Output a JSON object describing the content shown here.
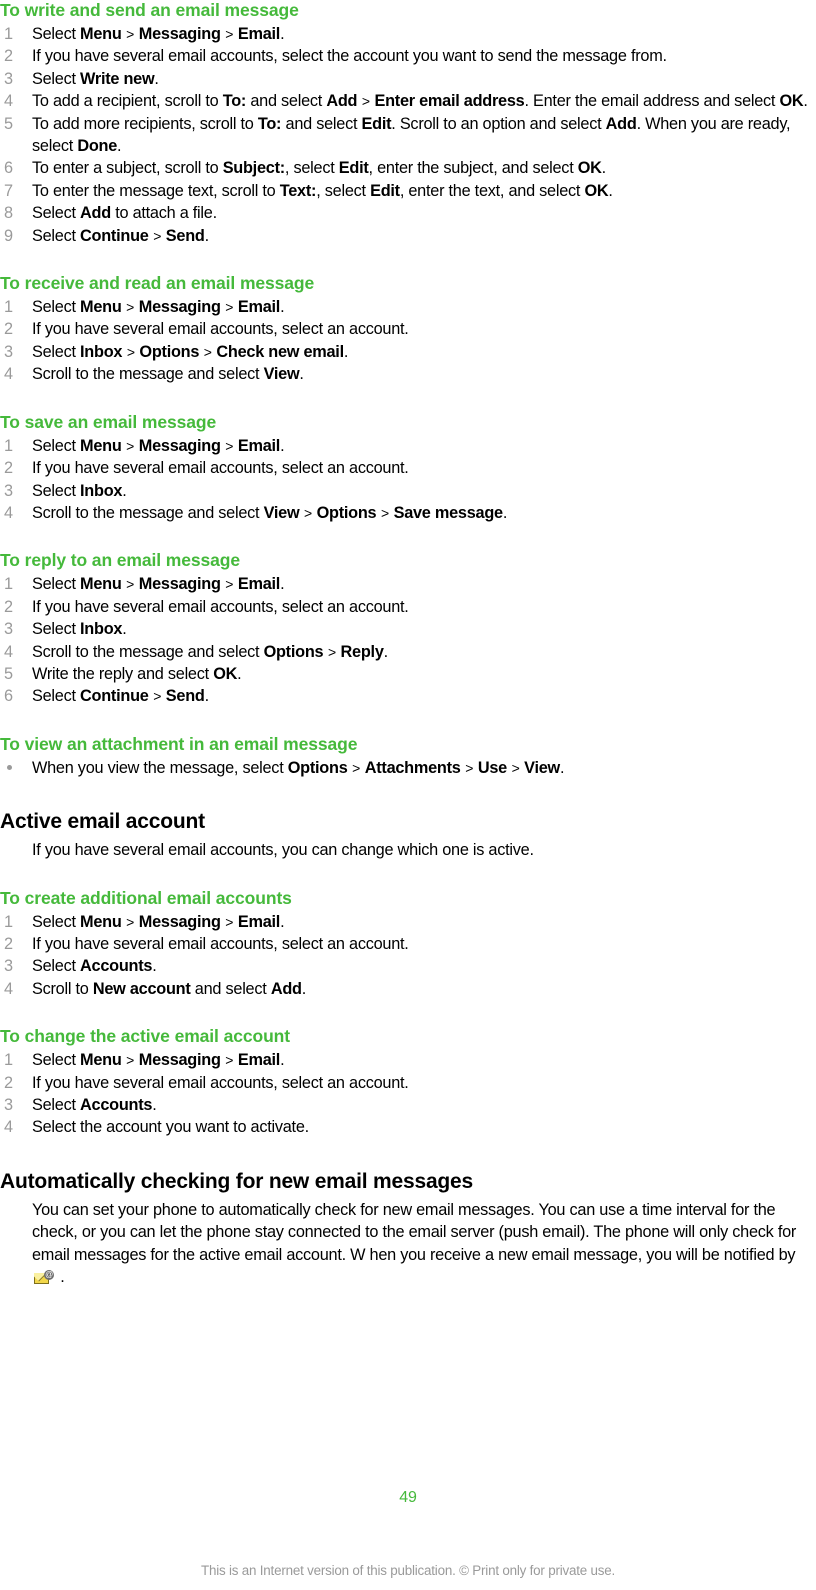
{
  "document": {
    "page_number": "49",
    "footer_note": "This is an Internet version of this publication. © Print only for private use.",
    "heading_color": "#45b93b",
    "number_color": "#9a9a9a",
    "body_color": "#000000"
  },
  "sections": [
    {
      "id": "write-send",
      "type": "procedure",
      "heading": "To write and send an email message",
      "steps": [
        {
          "num": "1",
          "parts": [
            {
              "t": "Select "
            },
            {
              "t": "Menu",
              "b": true
            },
            {
              "t": " > ",
              "gt": true
            },
            {
              "t": "Messaging",
              "b": true
            },
            {
              "t": " > ",
              "gt": true
            },
            {
              "t": "Email",
              "b": true
            },
            {
              "t": "."
            }
          ]
        },
        {
          "num": "2",
          "parts": [
            {
              "t": "If you have several email accounts, select the account you want to send the message from."
            }
          ]
        },
        {
          "num": "3",
          "parts": [
            {
              "t": "Select "
            },
            {
              "t": "Write new",
              "b": true
            },
            {
              "t": "."
            }
          ]
        },
        {
          "num": "4",
          "parts": [
            {
              "t": "To add a recipient, scroll to "
            },
            {
              "t": "To:",
              "b": true
            },
            {
              "t": " and select "
            },
            {
              "t": "Add",
              "b": true
            },
            {
              "t": " > ",
              "gt": true
            },
            {
              "t": "Enter email address",
              "b": true
            },
            {
              "t": ". Enter the email address and select "
            },
            {
              "t": "OK",
              "b": true
            },
            {
              "t": "."
            }
          ]
        },
        {
          "num": "5",
          "parts": [
            {
              "t": "To add more recipients, scroll to "
            },
            {
              "t": "To:",
              "b": true
            },
            {
              "t": " and select "
            },
            {
              "t": "Edit",
              "b": true
            },
            {
              "t": ". Scroll to an option and select "
            },
            {
              "t": "Add",
              "b": true
            },
            {
              "t": ". When you are ready, select "
            },
            {
              "t": "Done",
              "b": true
            },
            {
              "t": "."
            }
          ]
        },
        {
          "num": "6",
          "parts": [
            {
              "t": "To enter a subject, scroll to "
            },
            {
              "t": "Subject:",
              "b": true
            },
            {
              "t": ", select "
            },
            {
              "t": "Edit",
              "b": true
            },
            {
              "t": ", enter the subject, and select "
            },
            {
              "t": "OK",
              "b": true
            },
            {
              "t": "."
            }
          ]
        },
        {
          "num": "7",
          "parts": [
            {
              "t": "To enter the message text, scroll to "
            },
            {
              "t": "Text:",
              "b": true
            },
            {
              "t": ", select "
            },
            {
              "t": "Edit",
              "b": true
            },
            {
              "t": ", enter the text, and select "
            },
            {
              "t": "OK",
              "b": true
            },
            {
              "t": "."
            }
          ]
        },
        {
          "num": "8",
          "parts": [
            {
              "t": "Select "
            },
            {
              "t": "Add",
              "b": true
            },
            {
              "t": " to attach a file."
            }
          ]
        },
        {
          "num": "9",
          "parts": [
            {
              "t": "Select "
            },
            {
              "t": "Continue",
              "b": true
            },
            {
              "t": " > ",
              "gt": true
            },
            {
              "t": "Send",
              "b": true
            },
            {
              "t": "."
            }
          ]
        }
      ]
    },
    {
      "id": "receive-read",
      "type": "procedure",
      "heading": "To receive and read an email message",
      "steps": [
        {
          "num": "1",
          "parts": [
            {
              "t": "Select "
            },
            {
              "t": "Menu",
              "b": true
            },
            {
              "t": " > ",
              "gt": true
            },
            {
              "t": "Messaging",
              "b": true
            },
            {
              "t": " > ",
              "gt": true
            },
            {
              "t": "Email",
              "b": true
            },
            {
              "t": "."
            }
          ]
        },
        {
          "num": "2",
          "parts": [
            {
              "t": "If you have several email accounts, select an account."
            }
          ]
        },
        {
          "num": "3",
          "parts": [
            {
              "t": "Select "
            },
            {
              "t": "Inbox",
              "b": true
            },
            {
              "t": " > ",
              "gt": true
            },
            {
              "t": "Options",
              "b": true
            },
            {
              "t": " > ",
              "gt": true
            },
            {
              "t": "Check new email",
              "b": true
            },
            {
              "t": "."
            }
          ]
        },
        {
          "num": "4",
          "parts": [
            {
              "t": "Scroll to the message and select "
            },
            {
              "t": "View",
              "b": true
            },
            {
              "t": "."
            }
          ]
        }
      ]
    },
    {
      "id": "save",
      "type": "procedure",
      "heading": "To save an email message",
      "steps": [
        {
          "num": "1",
          "parts": [
            {
              "t": "Select "
            },
            {
              "t": "Menu",
              "b": true
            },
            {
              "t": " > ",
              "gt": true
            },
            {
              "t": "Messaging",
              "b": true
            },
            {
              "t": " > ",
              "gt": true
            },
            {
              "t": "Email",
              "b": true
            },
            {
              "t": "."
            }
          ]
        },
        {
          "num": "2",
          "parts": [
            {
              "t": "If you have several email accounts, select an account."
            }
          ]
        },
        {
          "num": "3",
          "parts": [
            {
              "t": "Select "
            },
            {
              "t": "Inbox",
              "b": true
            },
            {
              "t": "."
            }
          ]
        },
        {
          "num": "4",
          "parts": [
            {
              "t": "Scroll to the message and select "
            },
            {
              "t": "View",
              "b": true
            },
            {
              "t": " > ",
              "gt": true
            },
            {
              "t": "Options",
              "b": true
            },
            {
              "t": " > ",
              "gt": true
            },
            {
              "t": "Save message",
              "b": true
            },
            {
              "t": "."
            }
          ]
        }
      ]
    },
    {
      "id": "reply",
      "type": "procedure",
      "heading": "To reply to an email message",
      "steps": [
        {
          "num": "1",
          "parts": [
            {
              "t": "Select "
            },
            {
              "t": "Menu",
              "b": true
            },
            {
              "t": " > ",
              "gt": true
            },
            {
              "t": "Messaging",
              "b": true
            },
            {
              "t": " > ",
              "gt": true
            },
            {
              "t": "Email",
              "b": true
            },
            {
              "t": "."
            }
          ]
        },
        {
          "num": "2",
          "parts": [
            {
              "t": "If you have several email accounts, select an account."
            }
          ]
        },
        {
          "num": "3",
          "parts": [
            {
              "t": "Select "
            },
            {
              "t": "Inbox",
              "b": true
            },
            {
              "t": "."
            }
          ]
        },
        {
          "num": "4",
          "parts": [
            {
              "t": "Scroll to the message and select "
            },
            {
              "t": "Options",
              "b": true
            },
            {
              "t": " > ",
              "gt": true
            },
            {
              "t": "Reply",
              "b": true
            },
            {
              "t": "."
            }
          ]
        },
        {
          "num": "5",
          "parts": [
            {
              "t": "Write the reply and select "
            },
            {
              "t": "OK",
              "b": true
            },
            {
              "t": "."
            }
          ]
        },
        {
          "num": "6",
          "parts": [
            {
              "t": "Select "
            },
            {
              "t": "Continue",
              "b": true
            },
            {
              "t": " > ",
              "gt": true
            },
            {
              "t": "Send",
              "b": true
            },
            {
              "t": "."
            }
          ]
        }
      ]
    },
    {
      "id": "view-attachment",
      "type": "bullet-procedure",
      "heading": "To view an attachment in an email message",
      "steps": [
        {
          "parts": [
            {
              "t": "When you view the message, select "
            },
            {
              "t": "Options",
              "b": true
            },
            {
              "t": " > ",
              "gt": true
            },
            {
              "t": "Attachments",
              "b": true
            },
            {
              "t": " > ",
              "gt": true
            },
            {
              "t": "Use",
              "b": true
            },
            {
              "t": " > ",
              "gt": true
            },
            {
              "t": "View",
              "b": true
            },
            {
              "t": "."
            }
          ]
        }
      ]
    },
    {
      "id": "active-email-account",
      "type": "section",
      "heading": "Active email account",
      "paragraphs": [
        "If you have several email accounts, you can change which one is active."
      ]
    },
    {
      "id": "create-accounts",
      "type": "procedure",
      "heading": "To create additional email accounts",
      "steps": [
        {
          "num": "1",
          "parts": [
            {
              "t": "Select "
            },
            {
              "t": "Menu",
              "b": true
            },
            {
              "t": " > ",
              "gt": true
            },
            {
              "t": "Messaging",
              "b": true
            },
            {
              "t": " > ",
              "gt": true
            },
            {
              "t": "Email",
              "b": true
            },
            {
              "t": "."
            }
          ]
        },
        {
          "num": "2",
          "parts": [
            {
              "t": "If you have several email accounts, select an account."
            }
          ]
        },
        {
          "num": "3",
          "parts": [
            {
              "t": "Select "
            },
            {
              "t": "Accounts",
              "b": true
            },
            {
              "t": "."
            }
          ]
        },
        {
          "num": "4",
          "parts": [
            {
              "t": "Scroll to "
            },
            {
              "t": "New account",
              "b": true
            },
            {
              "t": " and select "
            },
            {
              "t": "Add",
              "b": true
            },
            {
              "t": "."
            }
          ]
        }
      ]
    },
    {
      "id": "change-active-account",
      "type": "procedure",
      "heading": "To change the active email account",
      "steps": [
        {
          "num": "1",
          "parts": [
            {
              "t": "Select "
            },
            {
              "t": "Menu",
              "b": true
            },
            {
              "t": " > ",
              "gt": true
            },
            {
              "t": "Messaging",
              "b": true
            },
            {
              "t": " > ",
              "gt": true
            },
            {
              "t": "Email",
              "b": true
            },
            {
              "t": "."
            }
          ]
        },
        {
          "num": "2",
          "parts": [
            {
              "t": "If you have several email accounts, select an account."
            }
          ]
        },
        {
          "num": "3",
          "parts": [
            {
              "t": "Select "
            },
            {
              "t": "Accounts",
              "b": true
            },
            {
              "t": "."
            }
          ]
        },
        {
          "num": "4",
          "parts": [
            {
              "t": "Select the account you want to activate."
            }
          ]
        }
      ]
    },
    {
      "id": "auto-check",
      "type": "section",
      "heading": "Automatically checking for new email messages",
      "paragraph_parts": [
        {
          "t": "You can set your phone to automatically check for new email messages. You can use a time interval for the check, or you can let the phone stay connected to the email server (push email). The phone will only check for email messages for the active email account. W hen you receive a new email message, you will be notified by "
        },
        {
          "icon": "email-at-icon"
        },
        {
          "t": " ."
        }
      ]
    }
  ]
}
